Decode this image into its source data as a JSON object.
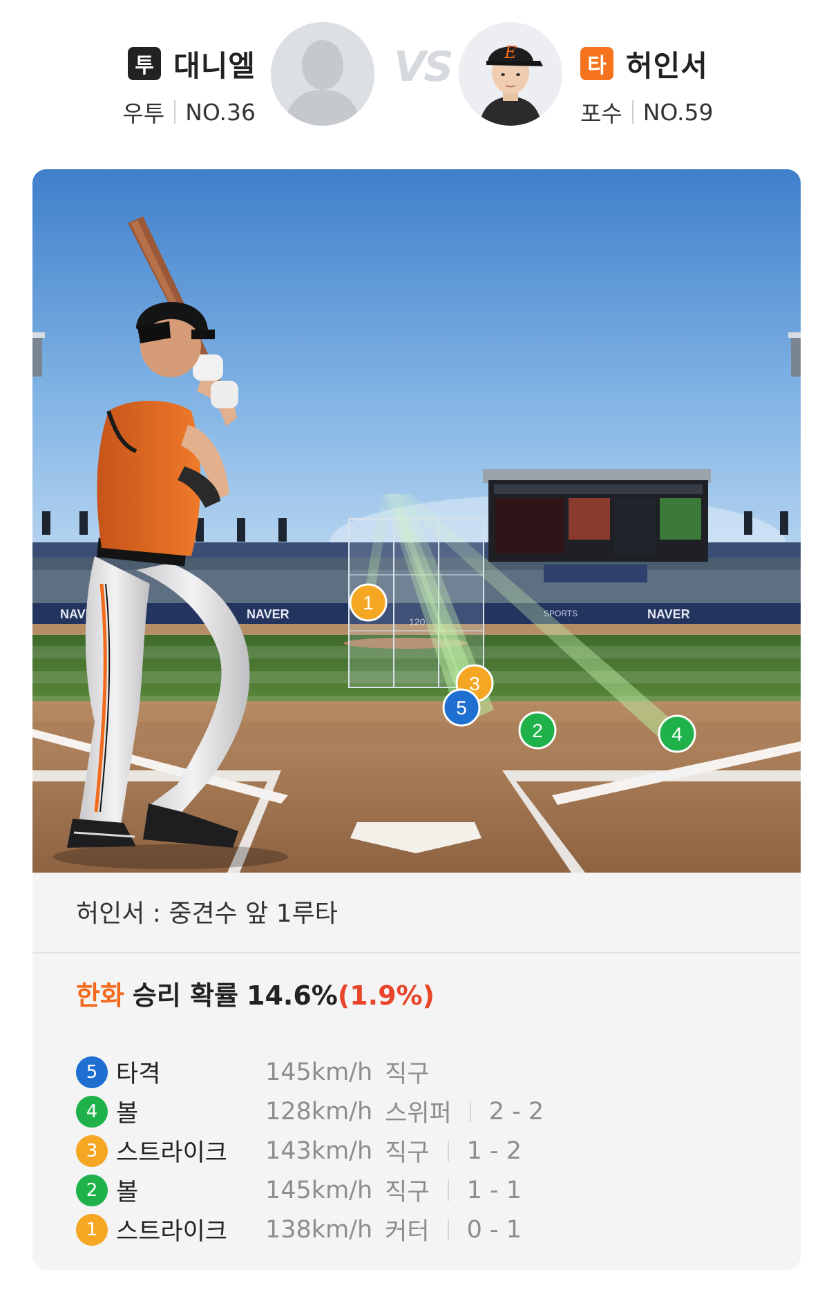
{
  "matchup": {
    "pitcher": {
      "badge": "투",
      "name": "대니엘",
      "hand": "우투",
      "number": "NO.36"
    },
    "vs": "VS",
    "batter": {
      "badge": "타",
      "name": "허인서",
      "position": "포수",
      "number": "NO.59"
    }
  },
  "scene": {
    "ad_text": "NAVER",
    "ad_text_sports": "SPORTS",
    "strike_zone_speed": "120",
    "pitch_markers": [
      {
        "num": "1",
        "color": "#f5a623"
      },
      {
        "num": "2",
        "color": "#1fb24a"
      },
      {
        "num": "3",
        "color": "#f5a623"
      },
      {
        "num": "4",
        "color": "#1fb24a"
      },
      {
        "num": "5",
        "color": "#1f6fd1"
      }
    ]
  },
  "result": {
    "play_description": "허인서 : 중견수 앞 1루타",
    "win_probability": {
      "team": "한화",
      "label": "승리 확률",
      "value": "14.6%",
      "delta": "(1.9%)"
    },
    "team_color": "#f26a1b",
    "delta_color": "#e8452a"
  },
  "pitches": [
    {
      "num": "5",
      "color": "#1f6fd1",
      "result": "타격",
      "speed": "145km/h",
      "type": "직구",
      "count": ""
    },
    {
      "num": "4",
      "color": "#1fb24a",
      "result": "볼",
      "speed": "128km/h",
      "type": "스위퍼",
      "count": "2 - 2"
    },
    {
      "num": "3",
      "color": "#f5a623",
      "result": "스트라이크",
      "speed": "143km/h",
      "type": "직구",
      "count": "1 - 2"
    },
    {
      "num": "2",
      "color": "#1fb24a",
      "result": "볼",
      "speed": "145km/h",
      "type": "직구",
      "count": "1 - 1"
    },
    {
      "num": "1",
      "color": "#f5a623",
      "result": "스트라이크",
      "speed": "138km/h",
      "type": "커터",
      "count": "0 - 1"
    }
  ]
}
